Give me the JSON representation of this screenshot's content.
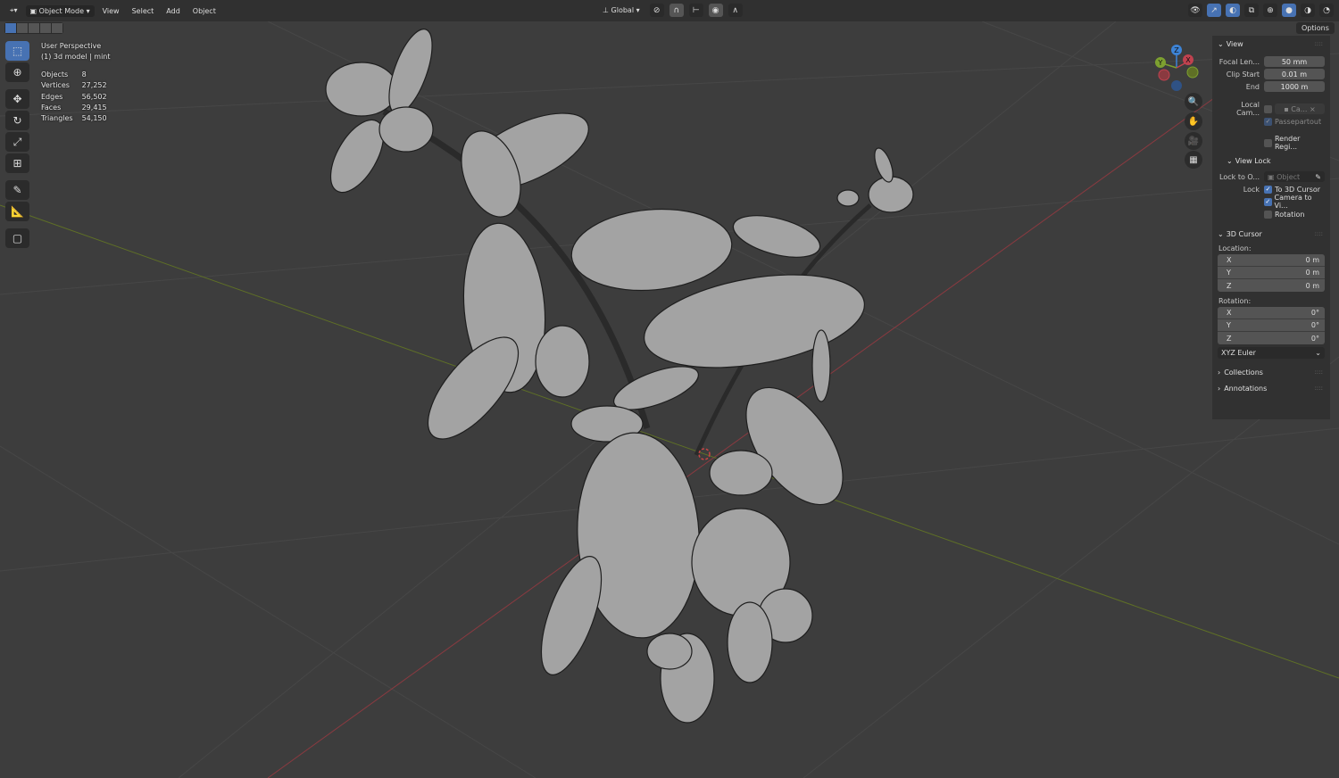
{
  "header": {
    "editor_type_icon": "editor-type-icon",
    "mode": "Object Mode",
    "menus": [
      "View",
      "Select",
      "Add",
      "Object"
    ],
    "orientation": "Global"
  },
  "overlay": {
    "view_name": "User Perspective",
    "object_info": "(1) 3d model | mint",
    "stats": [
      {
        "label": "Objects",
        "value": "8"
      },
      {
        "label": "Vertices",
        "value": "27,252"
      },
      {
        "label": "Edges",
        "value": "56,502"
      },
      {
        "label": "Faces",
        "value": "29,415"
      },
      {
        "label": "Triangles",
        "value": "54,150"
      }
    ]
  },
  "gizmo": {
    "x": "X",
    "y": "Y",
    "z": "Z"
  },
  "options_label": "Options",
  "panel": {
    "view": {
      "title": "View",
      "focal_label": "Focal Len...",
      "focal": "50 mm",
      "clip_start_label": "Clip Start",
      "clip_start": "0.01 m",
      "end_label": "End",
      "end": "1000 m",
      "local_cam_label": "Local Cam...",
      "local_cam_value": "Ca...",
      "passepartout": "Passepartout",
      "render_region": "Render Regi..."
    },
    "view_lock": {
      "title": "View Lock",
      "lock_to_label": "Lock to O...",
      "lock_to_placeholder": "Object",
      "lock_label": "Lock",
      "to_cursor": "To 3D Cursor",
      "camera_to_view": "Camera to Vi...",
      "rotation": "Rotation"
    },
    "cursor": {
      "title": "3D Cursor",
      "location_label": "Location:",
      "location": [
        {
          "axis": "X",
          "value": "0 m"
        },
        {
          "axis": "Y",
          "value": "0 m"
        },
        {
          "axis": "Z",
          "value": "0 m"
        }
      ],
      "rotation_label": "Rotation:",
      "rotation": [
        {
          "axis": "X",
          "value": "0°"
        },
        {
          "axis": "Y",
          "value": "0°"
        },
        {
          "axis": "Z",
          "value": "0°"
        }
      ],
      "rotation_mode": "XYZ Euler"
    },
    "collections": "Collections",
    "annotations": "Annotations"
  },
  "colors": {
    "accent": "#4772b3",
    "x_axis": "#c0424f",
    "y_axis": "#7da030",
    "z_axis": "#3d83d6"
  }
}
